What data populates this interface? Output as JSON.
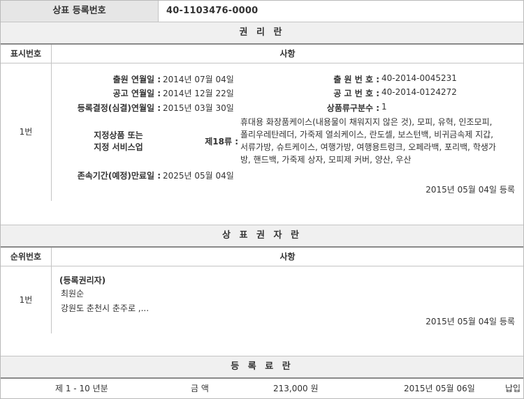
{
  "header": {
    "label": "상표 등록번호",
    "value": "40-1103476-0000"
  },
  "rights_section": {
    "title": "권 리 란",
    "col_num": "표시번호",
    "col_content": "사항",
    "row_num": "1번",
    "fields": {
      "app_date_label": "출원 연월일 :",
      "app_date": "2014년 07월 04일",
      "app_no_label": "출 원 번 호 :",
      "app_no": "40-2014-0045231",
      "pub_date_label": "공고 연월일 :",
      "pub_date": "2014년 12월 22일",
      "pub_no_label": "공 고 번 호 :",
      "pub_no": "40-2014-0124272",
      "reg_decision_label": "등록결정(심결)연월일 :",
      "reg_decision": "2015년 03월 30일",
      "class_count_label": "상품류구분수 :",
      "class_count": "1",
      "goods_label_1": "지정상품 또는",
      "goods_label_2": "지정 서비스업",
      "class_label": "제18류 :",
      "goods_1": "휴대용 화장품케이스(내용물이 채워지지 않은 것), 모피, 유혁, 인조모피,",
      "goods_2": "폴리우레탄레더, 가죽제 열쇠케이스, 란도셀, 보스턴백, 비귀금속제 지갑,",
      "goods_3": "서류가방, 슈트케이스, 여행가방, 여행용트렁크, 오페라백, 포리백, 학생가",
      "goods_4": "방, 핸드백, 가죽제 상자, 모피제 커버, 양산, 우산",
      "expiry_label": "존속기간(예정)만료일 :",
      "expiry": "2025년 05월 04일",
      "registered": "2015년 05월 04일 등록"
    }
  },
  "owner_section": {
    "title": "상 표 권 자 란",
    "col_num": "순위번호",
    "col_content": "사항",
    "row_num": "1번",
    "role": "(등록권리자)",
    "name": "최원순",
    "address": "강원도 춘천시 춘주로 ,...",
    "registered": "2015년 05월 04일 등록"
  },
  "fee_section": {
    "title": "등 록 료 란",
    "period": "제 1 - 10 년분",
    "amount_label": "금 액",
    "amount": "213,000 원",
    "date": "2015년 05월 06일",
    "status": "납입"
  }
}
